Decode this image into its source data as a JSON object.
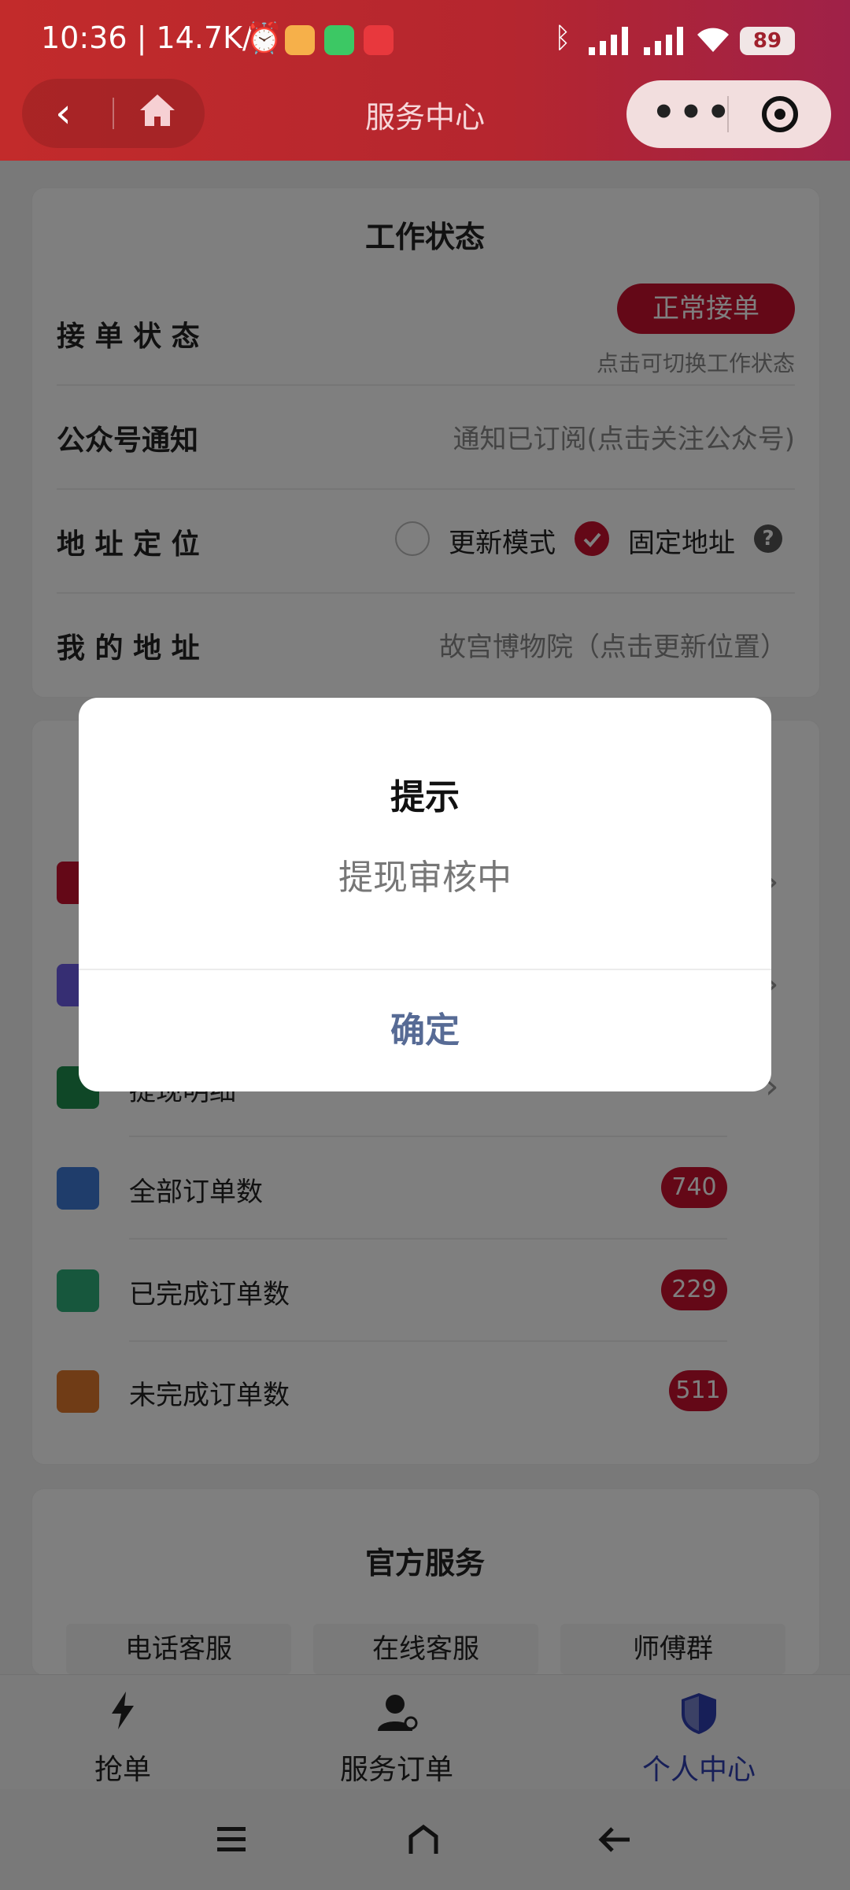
{
  "status_bar": {
    "time": "10:36 | 14.7K/s",
    "battery": "89"
  },
  "header": {
    "title": "服务中心"
  },
  "work_status": {
    "section_title": "工作状态",
    "rows": {
      "order_status": {
        "label": "接 单 状 态",
        "button": "正常接单",
        "hint": "点击可切换工作状态"
      },
      "notification": {
        "label": "公众号通知",
        "value": "通知已订阅(点击关注公众号)"
      },
      "location": {
        "label": "地 址 定 位",
        "option_update": "更新模式",
        "option_fixed": "固定地址",
        "help": "?"
      },
      "address": {
        "label": "我 的 地 址",
        "value": "故宫博物院（点击更新位置）"
      }
    }
  },
  "list": {
    "partial_item": "提现明细",
    "items": [
      {
        "label": "全部订单数",
        "count": "740"
      },
      {
        "label": "已完成订单数",
        "count": "229"
      },
      {
        "label": "未完成订单数",
        "count": "511"
      }
    ]
  },
  "official_service": {
    "section_title": "官方服务",
    "buttons": [
      "电话客服",
      "在线客服",
      "师傅群"
    ]
  },
  "tabbar": {
    "tabs": [
      {
        "label": "抢单"
      },
      {
        "label": "服务订单"
      },
      {
        "label": "个人中心"
      }
    ]
  },
  "dialog": {
    "title": "提示",
    "message": "提现审核中",
    "confirm": "确定"
  },
  "colors": {
    "brand_red": "#c8102e",
    "active_tab": "#2f3fb0",
    "dialog_button": "#576b95"
  }
}
